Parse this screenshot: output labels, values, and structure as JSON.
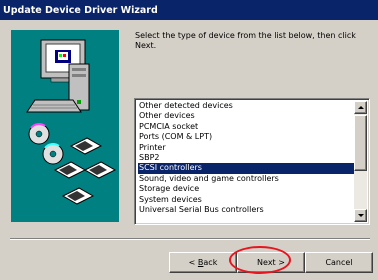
{
  "window": {
    "title": "Update Device Driver Wizard"
  },
  "instructions": "Select the type of device from the list below, then click Next.",
  "device_list": {
    "items": [
      "Other detected devices",
      "Other devices",
      "PCMCIA socket",
      "Ports (COM & LPT)",
      "Printer",
      "SBP2",
      "SCSI controllers",
      "Sound, video and game controllers",
      "Storage device",
      "System devices",
      "Universal Serial Bus controllers"
    ],
    "selected": "SCSI controllers"
  },
  "buttons": {
    "back_prefix": "< ",
    "back_mnemonic": "B",
    "back_rest": "ack",
    "next_label": "Next >",
    "cancel_label": "Cancel"
  },
  "colors": {
    "titlebar": "#0a246a",
    "selection": "#0a246a",
    "illustration_bg": "#008080",
    "highlight_oval": "#e8141e"
  },
  "icons": [
    "computer-icon",
    "cd-disc-icon",
    "floppy-disk-icon",
    "scroll-up-icon",
    "scroll-down-icon"
  ]
}
